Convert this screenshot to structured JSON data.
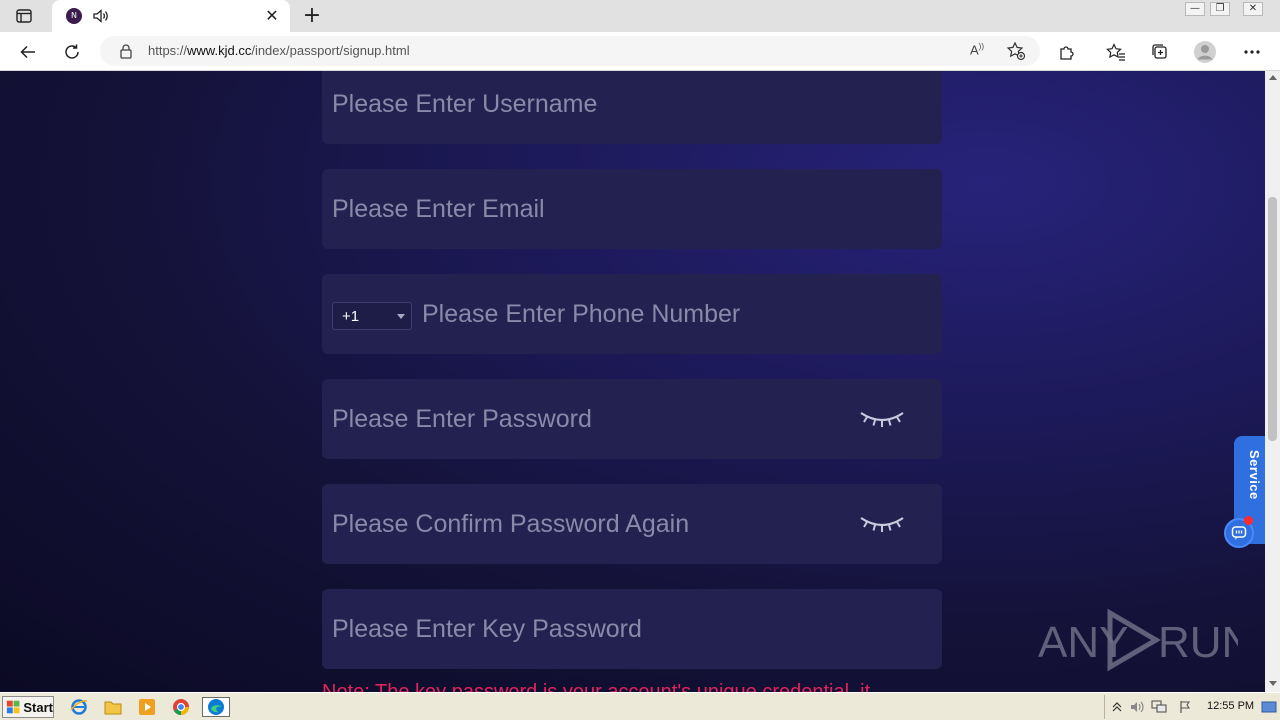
{
  "browser": {
    "tab": {
      "favicon_letter": "N",
      "close_glyph": "✕"
    },
    "new_tab_glyph": "+",
    "window_buttons": [
      "—",
      "❐",
      "✕"
    ],
    "url": {
      "prefix": "https://",
      "domain": "www.kjd.cc",
      "path": "/index/passport/signup.html"
    },
    "read_aloud_glyph": "A",
    "icons": [
      "back-icon",
      "refresh-icon",
      "lock-icon",
      "read-aloud-icon",
      "add-favorite-icon",
      "extensions-icon",
      "favorites-icon",
      "collections-icon",
      "profile-icon",
      "more-icon"
    ]
  },
  "form": {
    "username_placeholder": "Please Enter Username",
    "email_placeholder": "Please Enter Email",
    "phone": {
      "country_code": "+1",
      "placeholder": "Please Enter Phone Number"
    },
    "password_placeholder": "Please Enter Password",
    "confirm_placeholder": "Please Confirm Password Again",
    "key_password_placeholder": "Please Enter Key Password",
    "note": "Note: The key password is your account's unique credential, it"
  },
  "service_widget": {
    "label": "Service"
  },
  "watermark": {
    "text_left": "ANY",
    "text_right": "RUN"
  },
  "taskbar": {
    "start_label": "Start",
    "clock": "12:55 PM",
    "apps": [
      "ie-icon",
      "explorer-icon",
      "media-player-icon",
      "chrome-icon",
      "edge-icon"
    ]
  },
  "colors": {
    "field_bg": "#232150",
    "placeholder": "#8a89a9",
    "note": "#e0245e",
    "service": "#2f6fe0"
  }
}
